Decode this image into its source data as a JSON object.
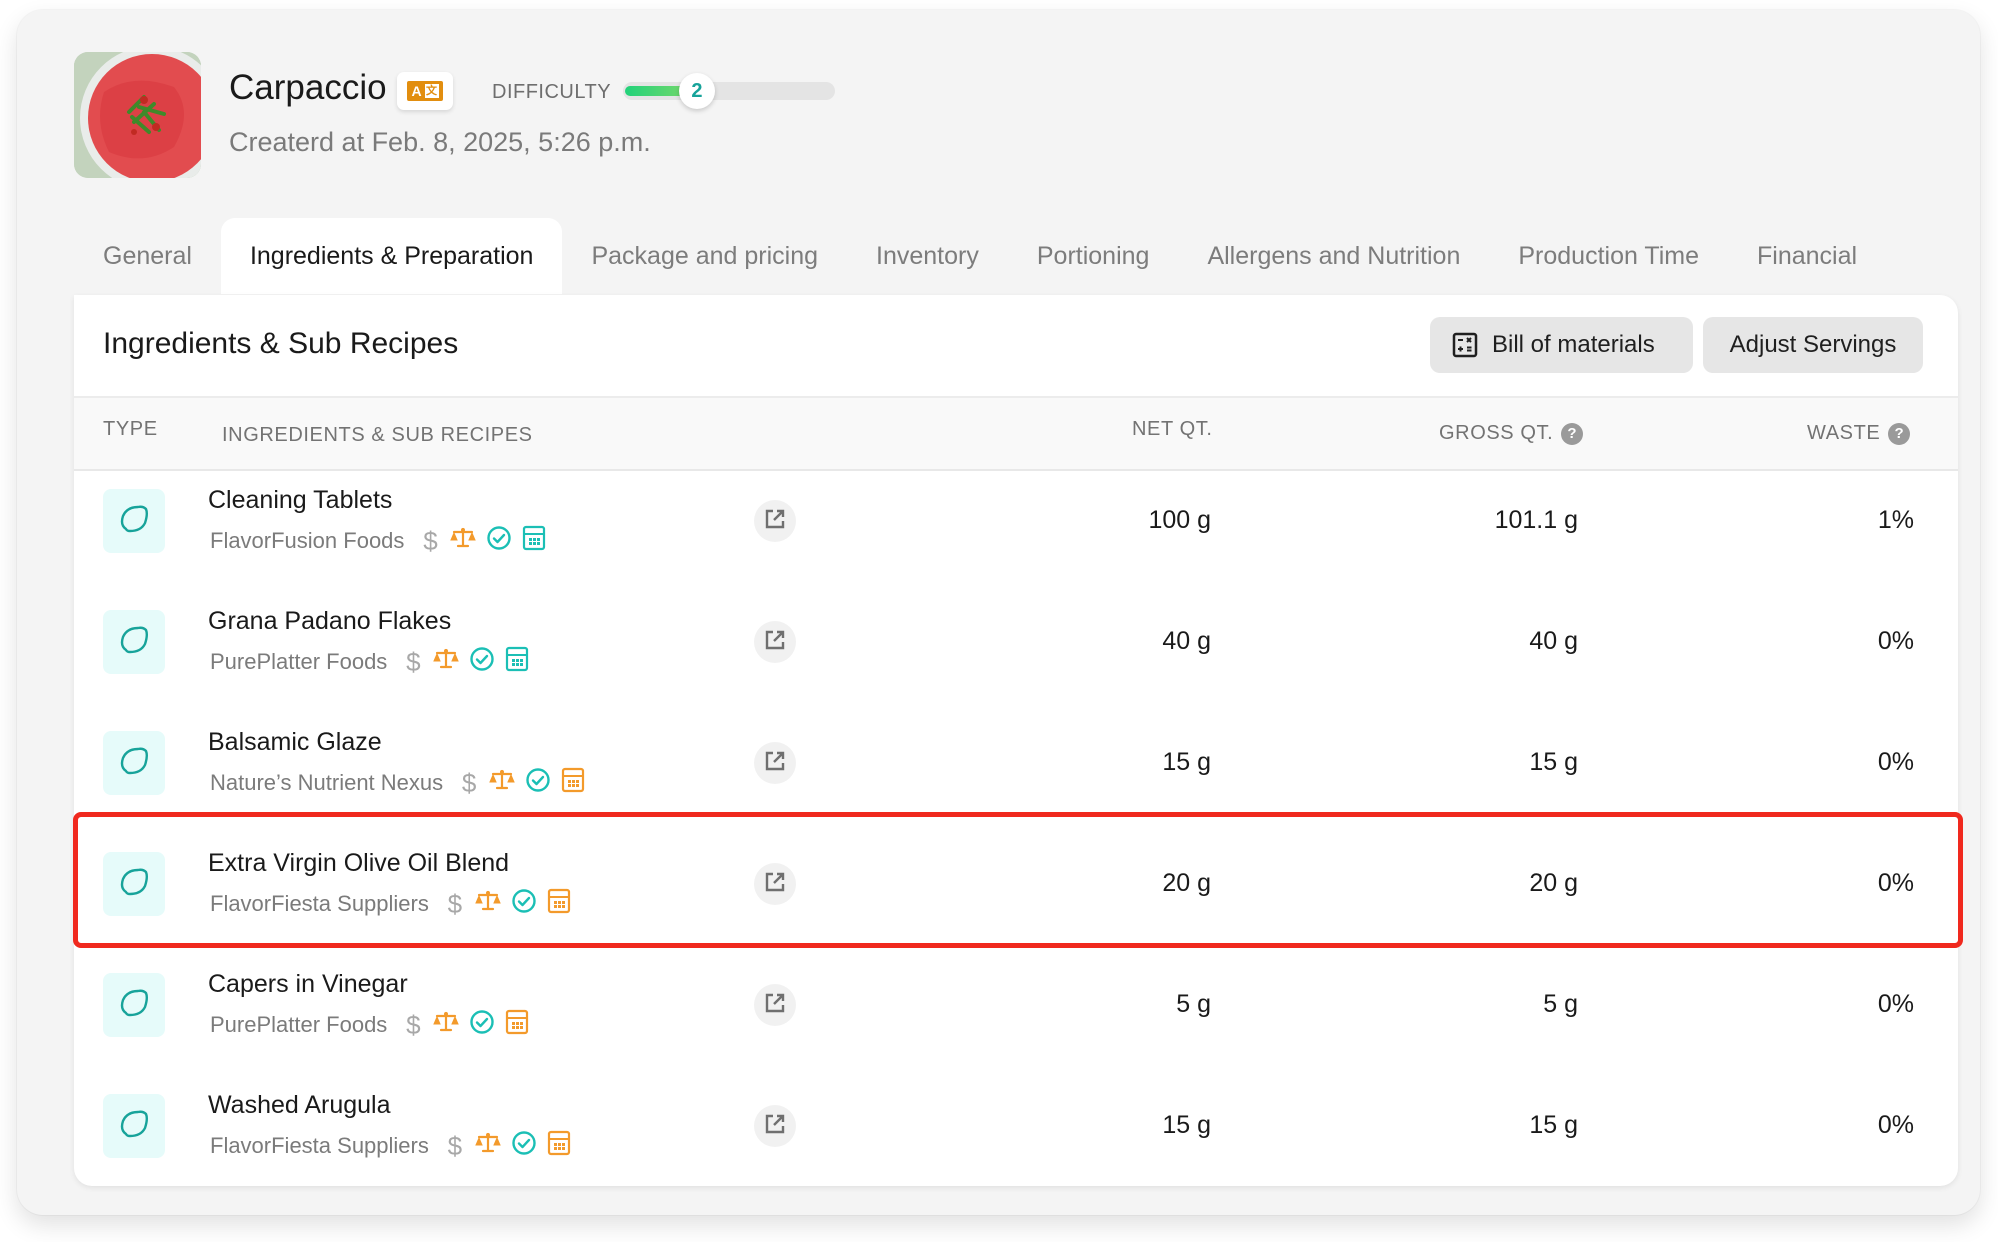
{
  "recipe": {
    "title": "Carpaccio",
    "translate_icon": "translate-icon",
    "difficulty_label": "DIFFICULTY",
    "difficulty_value": "2",
    "difficulty_fraction": 0.33,
    "created_text": "Createrd at Feb. 8, 2025, 5:26 p.m."
  },
  "tabs": [
    {
      "label": "General",
      "active": false
    },
    {
      "label": "Ingredients & Preparation",
      "active": true
    },
    {
      "label": "Package and pricing",
      "active": false
    },
    {
      "label": "Inventory",
      "active": false
    },
    {
      "label": "Portioning",
      "active": false
    },
    {
      "label": "Allergens and Nutrition",
      "active": false
    },
    {
      "label": "Production Time",
      "active": false
    },
    {
      "label": "Financial",
      "active": false
    }
  ],
  "section": {
    "title": "Ingredients & Sub Recipes",
    "bom_label": "Bill of materials",
    "adjust_label": "Adjust Servings"
  },
  "table": {
    "headers": {
      "type": "TYPE",
      "ingredients": "INGREDIENTS & SUB RECIPES",
      "net": "NET QT.",
      "gross": "GROSS QT.",
      "waste": "WASTE",
      "help_glyph": "?"
    },
    "rows": [
      {
        "name": "Cleaning Tablets",
        "supplier": "FlavorFusion Foods",
        "net": "100 g",
        "gross": "101.1 g",
        "waste": "1%",
        "calc_color": "#1bbfb5"
      },
      {
        "name": "Grana Padano Flakes",
        "supplier": "PurePlatter Foods",
        "net": "40 g",
        "gross": "40 g",
        "waste": "0%",
        "calc_color": "#1bbfb5"
      },
      {
        "name": "Balsamic Glaze",
        "supplier": "Nature’s Nutrient Nexus",
        "net": "15 g",
        "gross": "15 g",
        "waste": "0%",
        "calc_color": "#f39a2b"
      },
      {
        "name": "Extra Virgin Olive Oil Blend",
        "supplier": "FlavorFiesta Suppliers",
        "net": "20 g",
        "gross": "20 g",
        "waste": "0%",
        "calc_color": "#f39a2b",
        "highlighted": true
      },
      {
        "name": "Capers in Vinegar",
        "supplier": "PurePlatter Foods",
        "net": "5 g",
        "gross": "5 g",
        "waste": "0%",
        "calc_color": "#f39a2b"
      },
      {
        "name": "Washed Arugula",
        "supplier": "FlavorFiesta Suppliers",
        "net": "15 g",
        "gross": "15 g",
        "waste": "0%",
        "calc_color": "#f39a2b"
      }
    ]
  },
  "icons": {
    "dollar_glyph": "$"
  },
  "colors": {
    "accent_teal": "#1bbfb5",
    "accent_orange": "#f39a2b",
    "highlight_red": "#f0291e",
    "translate_orange": "#e28e0f"
  }
}
